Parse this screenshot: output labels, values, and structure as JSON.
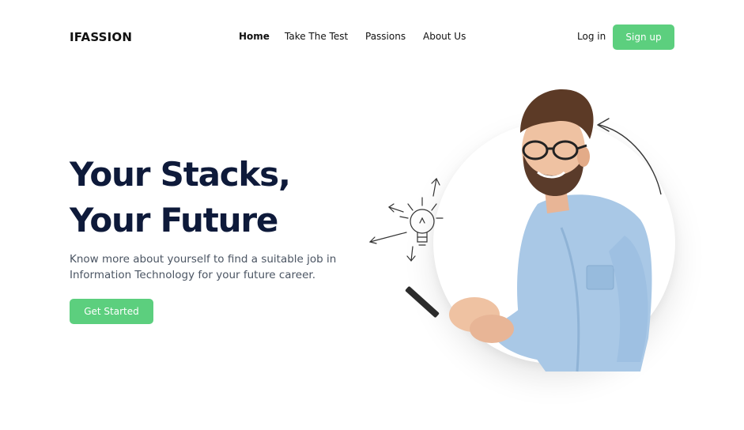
{
  "brand": {
    "logo": "IFASSION"
  },
  "nav": {
    "items": [
      {
        "label": "Home"
      },
      {
        "label": "Take The Test"
      },
      {
        "label": "Passions"
      },
      {
        "label": "About Us"
      }
    ],
    "login": "Log in",
    "signup": "Sign up"
  },
  "hero": {
    "title_line1": "Your Stacks,",
    "title_line2": "Your Future",
    "subtitle": "Know more about yourself to find a suitable job in Information Technology for your future career.",
    "cta": "Get Started"
  },
  "colors": {
    "accent": "#5ccf7e",
    "title": "#0e1a3a",
    "shirt": "#a9c8e6"
  },
  "icons": [
    "lightbulb-icon",
    "arrow-icon"
  ]
}
